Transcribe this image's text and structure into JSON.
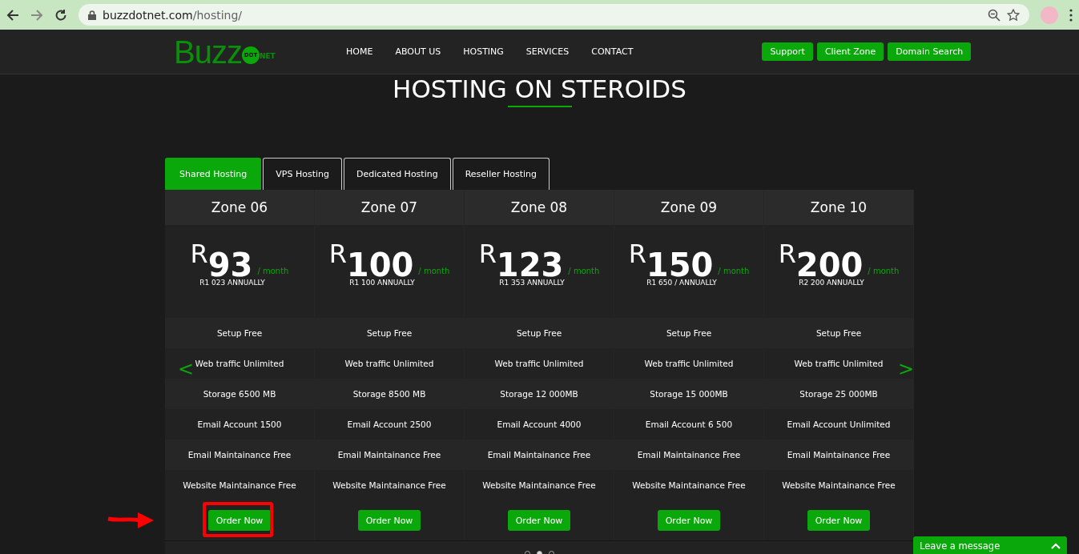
{
  "browser": {
    "url_host": "buzzdotnet.com",
    "url_path": "/hosting/"
  },
  "logo": {
    "word": "Buzz",
    "circle": "DOT",
    "suffix": "NET"
  },
  "nav": [
    {
      "label": "HOME"
    },
    {
      "label": "ABOUT US"
    },
    {
      "label": "HOSTING"
    },
    {
      "label": "SERVICES"
    },
    {
      "label": "CONTACT"
    }
  ],
  "nav_buttons": [
    "Support",
    "Client Zone",
    "Domain Search"
  ],
  "heading": "HOSTING ON STEROIDS",
  "tabs": [
    {
      "label": "Shared Hosting",
      "selected": true
    },
    {
      "label": "VPS Hosting",
      "selected": false
    },
    {
      "label": "Dedicated Hosting",
      "selected": false
    },
    {
      "label": "Reseller Hosting",
      "selected": false
    }
  ],
  "plans": [
    {
      "name": "Zone 06",
      "currency": "R",
      "amount": "93",
      "period": "/ month",
      "annual": "R1 023 ANNUALLY",
      "features": [
        "Setup Free",
        "Web traffic Unlimited",
        "Storage 6500 MB",
        "Email Account 1500",
        "Email Maintainance Free",
        "Website Maintainance Free"
      ],
      "button": "Order Now",
      "highlighted": true
    },
    {
      "name": "Zone 07",
      "currency": "R",
      "amount": "100",
      "period": "/ month",
      "annual": "R1 100 ANNUALLY",
      "features": [
        "Setup Free",
        "Web traffic Unlimited",
        "Storage 8500 MB",
        "Email Account 2500",
        "Email Maintainance Free",
        "Website Maintainance Free"
      ],
      "button": "Order Now",
      "highlighted": false
    },
    {
      "name": "Zone 08",
      "currency": "R",
      "amount": "123",
      "period": "/ month",
      "annual": "R1 353 ANNUALLY",
      "features": [
        "Setup Free",
        "Web traffic Unlimited",
        "Storage 12 000MB",
        "Email Account 4000",
        "Email Maintainance Free",
        "Website Maintainance Free"
      ],
      "button": "Order Now",
      "highlighted": false
    },
    {
      "name": "Zone 09",
      "currency": "R",
      "amount": "150",
      "period": "/ month",
      "annual": "R1 650 / ANNUALLY",
      "features": [
        "Setup Free",
        "Web traffic Unlimited",
        "Storage 15 000MB",
        "Email Account 6 500",
        "Email Maintainance Free",
        "Website Maintainance Free"
      ],
      "button": "Order Now",
      "highlighted": false
    },
    {
      "name": "Zone 10",
      "currency": "R",
      "amount": "200",
      "period": "/ month",
      "annual": "R2 200 ANNUALLY",
      "features": [
        "Setup Free",
        "Web traffic Unlimited",
        "Storage 25 000MB",
        "Email Account Unlimited",
        "Email Maintainance Free",
        "Website Maintainance Free"
      ],
      "button": "Order Now",
      "highlighted": false
    }
  ],
  "carousel": {
    "prev": "<",
    "next": ">",
    "dots": [
      {
        "selected": false
      },
      {
        "selected": true
      },
      {
        "selected": false
      }
    ]
  },
  "chat": {
    "label": "Leave a message"
  }
}
